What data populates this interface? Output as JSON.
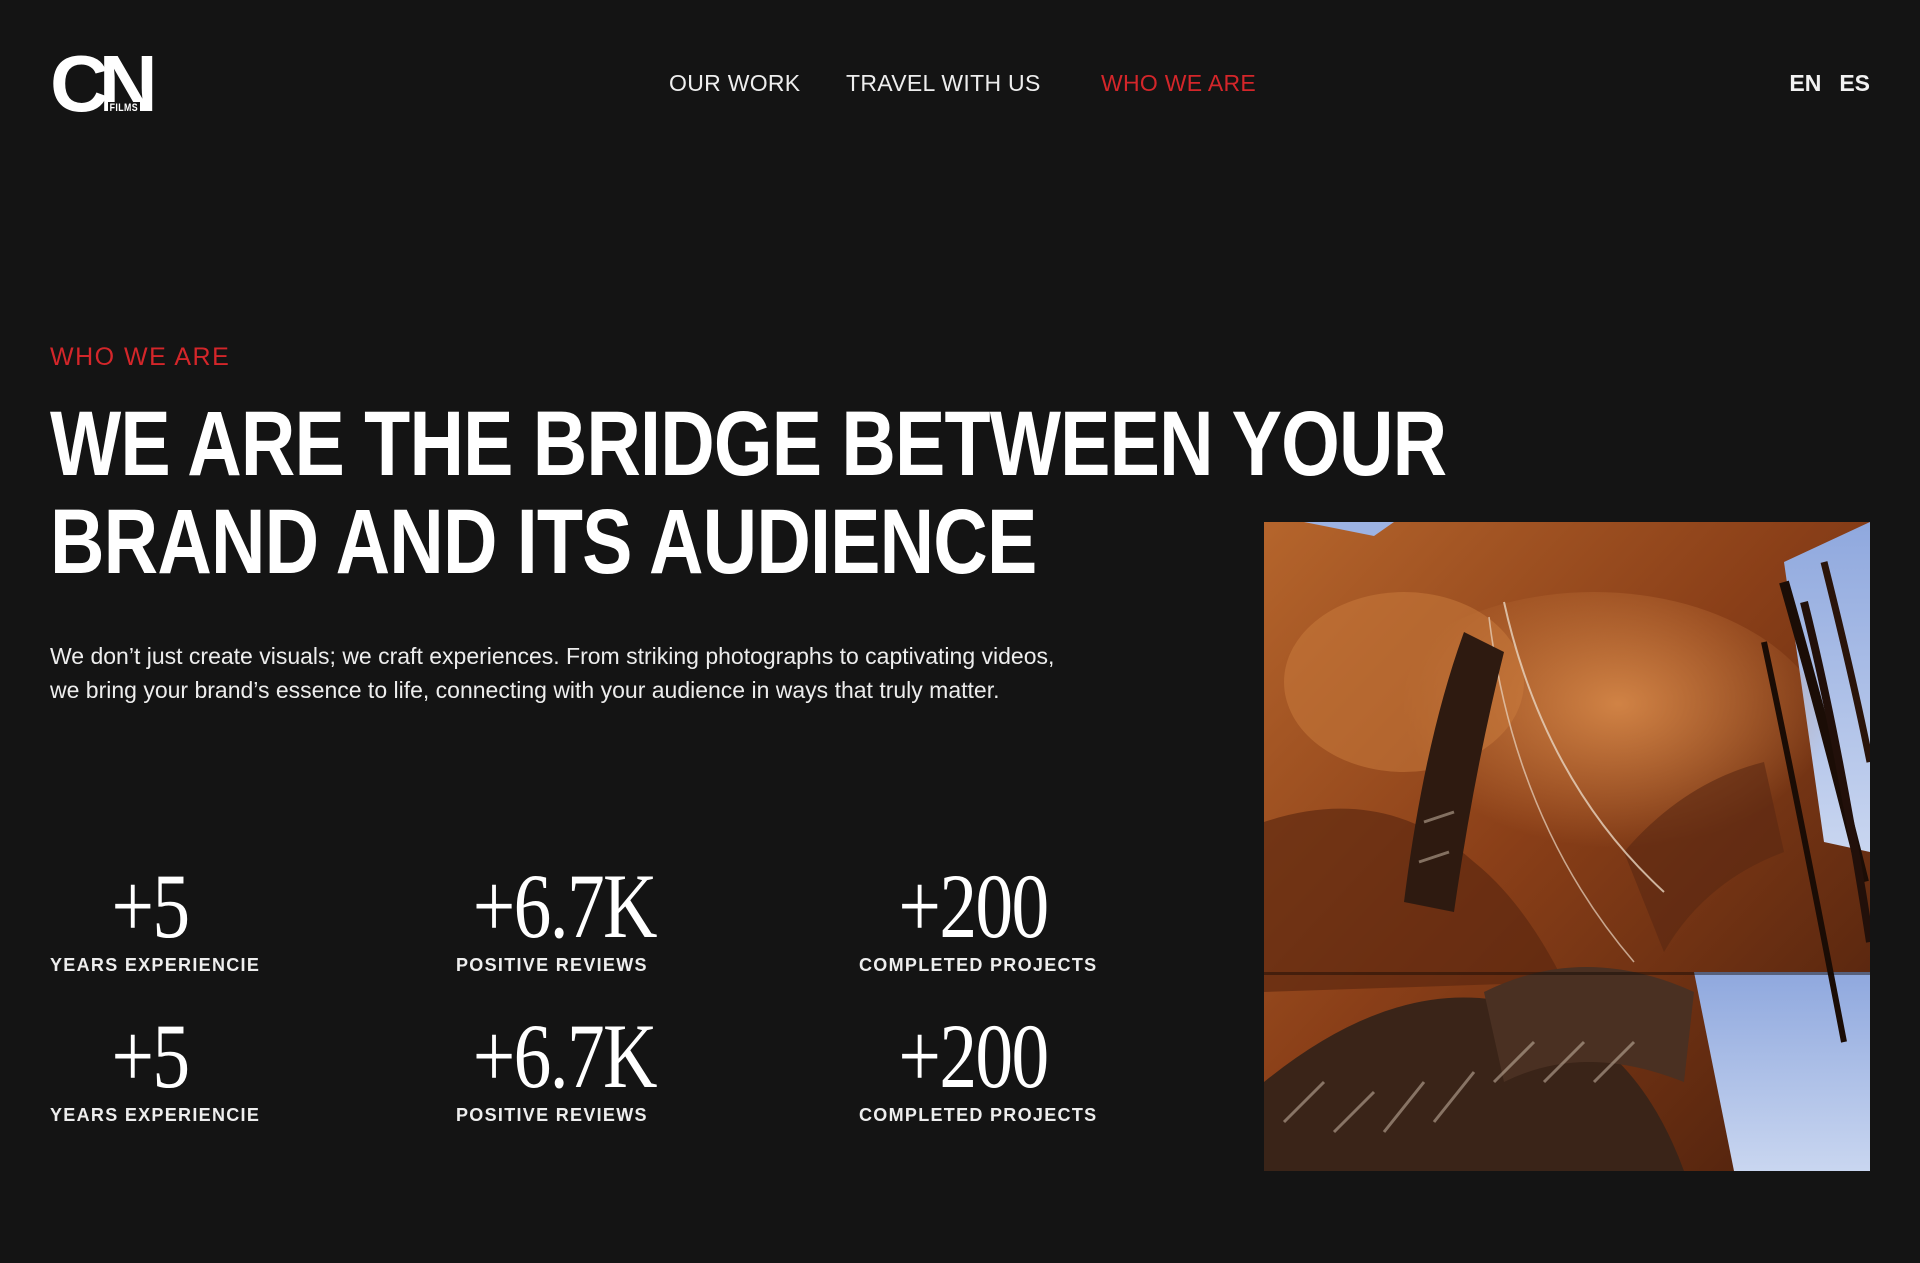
{
  "header": {
    "logo_mark": "CN",
    "logo_sub": "FILMS",
    "nav": [
      {
        "label": "OUR WORK",
        "active": false
      },
      {
        "label": "TRAVEL WITH US",
        "active": false
      },
      {
        "label": "WHO WE ARE",
        "active": true
      }
    ],
    "languages": [
      "EN",
      "ES"
    ]
  },
  "hero": {
    "eyebrow": "WHO WE ARE",
    "headline_line1": "WE ARE THE BRIDGE BETWEEN YOUR",
    "headline_line2": "BRAND AND ITS AUDIENCE",
    "lead": "We don’t just create visuals; we craft experiences. From striking photographs to captivating videos, we bring your brand’s essence to life, connecting with your audience in ways that truly matter."
  },
  "stats": [
    {
      "value": "+5",
      "label": "YEARS EXPERIENCIE"
    },
    {
      "value": "+6.7K",
      "label": "POSITIVE REVIEWS"
    },
    {
      "value": "+200",
      "label": "COMPLETED PROJECTS"
    },
    {
      "value": "+5",
      "label": "YEARS EXPERIENCIE"
    },
    {
      "value": "+6.7K",
      "label": "POSITIVE REVIEWS"
    },
    {
      "value": "+200",
      "label": "COMPLETED PROJECTS"
    }
  ],
  "colors": {
    "background": "#141414",
    "accent": "#d4262a",
    "text": "#ffffff"
  }
}
